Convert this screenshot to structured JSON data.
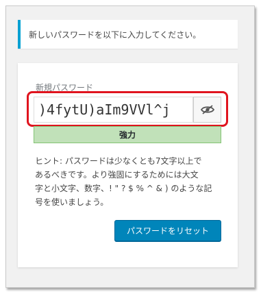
{
  "notice": {
    "message": "新しいパスワードを以下に入力してください。"
  },
  "form": {
    "password_label": "新規パスワード",
    "password_value": ")4fytU)aIm9VVl^j",
    "toggle_icon": "eye-slash-icon",
    "strength_label": "強力",
    "hint_lines": [
      "ヒント: パスワードは少なくとも7文字以上で",
      "あるべきです。より強固にするためには大文",
      "字と小文字、数字、! \" ? $ % ^ & ) のような記",
      "号を使いましょう。"
    ],
    "reset_button": "パスワードをリセット"
  },
  "colors": {
    "notice_accent": "#00a0d2",
    "highlight_border": "#e0141e",
    "strength_bg": "#c1e1b9",
    "strength_border": "#83c373",
    "primary_button": "#0085ba"
  }
}
